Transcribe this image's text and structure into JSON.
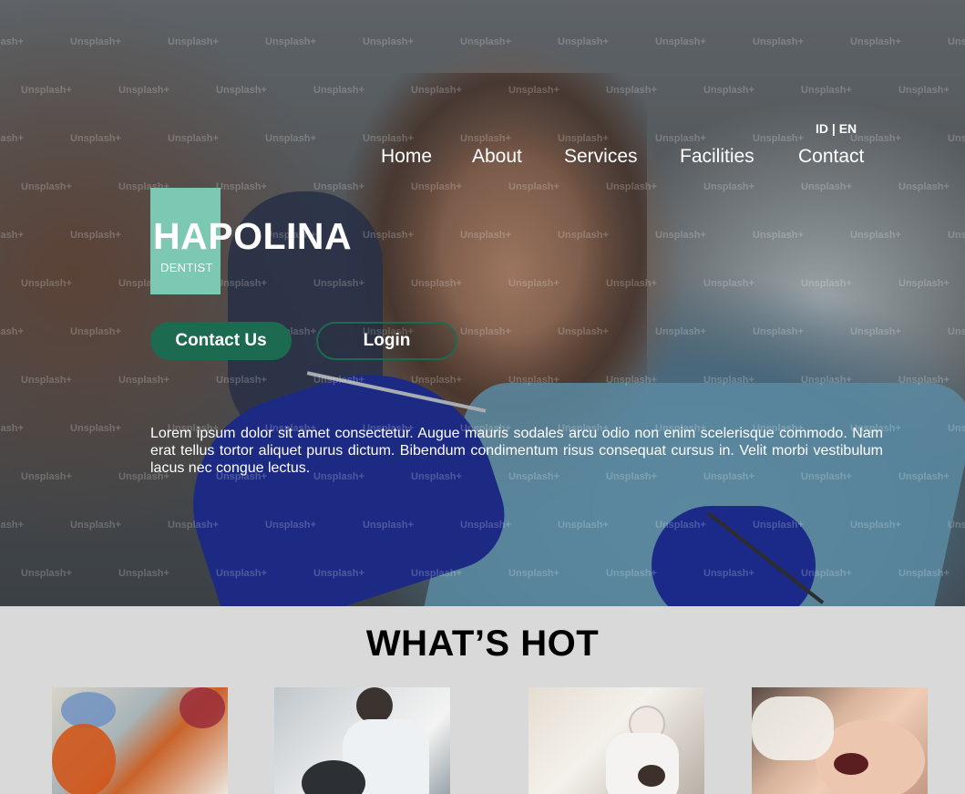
{
  "header": {
    "language": "ID | EN",
    "nav": [
      {
        "label": "Home"
      },
      {
        "label": "About"
      },
      {
        "label": "Services"
      },
      {
        "label": "Facilities"
      },
      {
        "label": "Contact"
      }
    ]
  },
  "brand": {
    "title": "HAPOLINA",
    "subtitle": "DENTIST",
    "accent_color": "#7cc8b3"
  },
  "hero": {
    "contact_button": "Contact Us",
    "login_button": "Login",
    "button_color": "#1c6a4f",
    "description": "Lorem ipsum dolor sit amet consectetur. Augue mauris sodales arcu odio non enim scelerisque commodo. Nam erat tellus tortor aliquet purus dictum. Bibendum condimentum risus consequat cursus in. Velit morbi vestibulum lacus nec congue lectus.",
    "watermark": "Unsplash+"
  },
  "whats_hot": {
    "title": "WHAT’S HOT",
    "cards": [
      {
        "image": "dentists-treating-patient-photo"
      },
      {
        "image": "dentist-with-loupes-photo"
      },
      {
        "image": "dentist-examining-patient-photo"
      },
      {
        "image": "smiling-patient-mirror-photo"
      }
    ]
  }
}
